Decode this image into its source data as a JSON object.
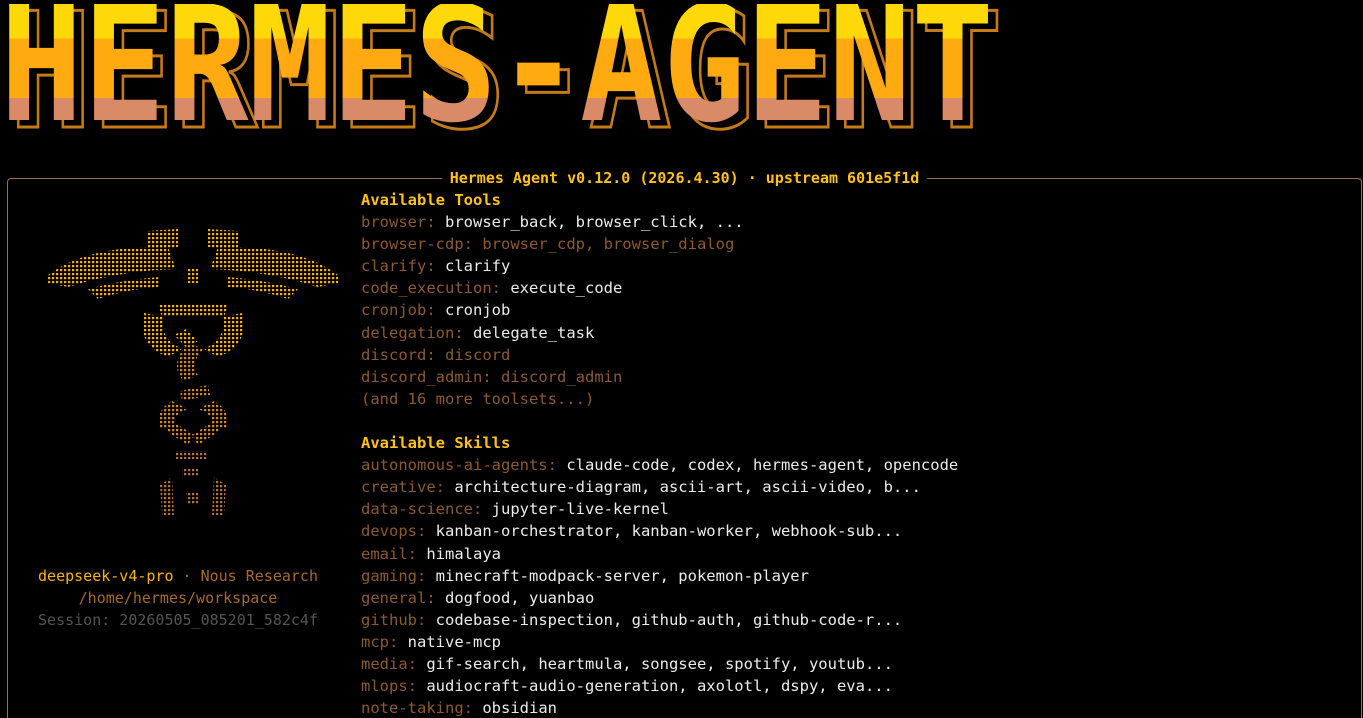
{
  "banner": {
    "text": "HERMES-AGENT"
  },
  "panel": {
    "title": "Hermes Agent v0.12.0 (2026.4.30) · upstream 601e5f1d",
    "model": "deepseek-v4-pro",
    "separator": "·",
    "vendor": "Nous Research",
    "workdir": "/home/hermes/workspace",
    "session": "Session: 20260505_085201_582c4f"
  },
  "tools": {
    "title": "Available Tools",
    "items": [
      {
        "category": "browser:",
        "value": "browser_back, browser_click, ...",
        "dim": false
      },
      {
        "category": "browser-cdp:",
        "value": "browser_cdp, browser_dialog",
        "dim": true
      },
      {
        "category": "clarify:",
        "value": "clarify",
        "dim": false
      },
      {
        "category": "code_execution:",
        "value": "execute_code",
        "dim": false
      },
      {
        "category": "cronjob:",
        "value": "cronjob",
        "dim": false
      },
      {
        "category": "delegation:",
        "value": "delegate_task",
        "dim": false
      },
      {
        "category": "discord:",
        "value": "discord",
        "dim": true
      },
      {
        "category": "discord_admin:",
        "value": "discord_admin",
        "dim": true
      }
    ],
    "more": "(and 16 more toolsets...)"
  },
  "skills": {
    "title": "Available Skills",
    "items": [
      {
        "category": "autonomous-ai-agents:",
        "value": "claude-code, codex, hermes-agent, opencode"
      },
      {
        "category": "creative:",
        "value": "architecture-diagram, ascii-art, ascii-video, b..."
      },
      {
        "category": "data-science:",
        "value": "jupyter-live-kernel"
      },
      {
        "category": "devops:",
        "value": "kanban-orchestrator, kanban-worker, webhook-sub..."
      },
      {
        "category": "email:",
        "value": "himalaya"
      },
      {
        "category": "gaming:",
        "value": "minecraft-modpack-server, pokemon-player"
      },
      {
        "category": "general:",
        "value": "dogfood, yuanbao"
      },
      {
        "category": "github:",
        "value": "codebase-inspection, github-auth, github-code-r..."
      },
      {
        "category": "mcp:",
        "value": "native-mcp"
      },
      {
        "category": "media:",
        "value": "gif-search, heartmula, songsee, spotify, youtub..."
      },
      {
        "category": "mlops:",
        "value": "audiocraft-audio-generation, axolotl, dspy, eva..."
      },
      {
        "category": "note-taking:",
        "value": "obsidian"
      }
    ]
  },
  "colors": {
    "title": "#ffc21a",
    "category": "#8c5a2e",
    "value": "#ececec",
    "border": "#9a6c52"
  }
}
